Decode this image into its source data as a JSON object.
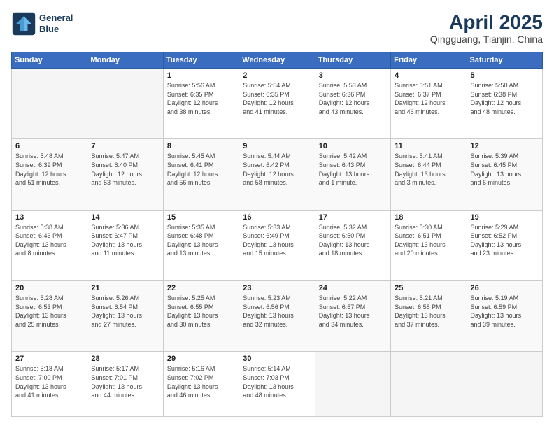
{
  "header": {
    "logo_line1": "General",
    "logo_line2": "Blue",
    "title": "April 2025",
    "subtitle": "Qingguang, Tianjin, China"
  },
  "weekdays": [
    "Sunday",
    "Monday",
    "Tuesday",
    "Wednesday",
    "Thursday",
    "Friday",
    "Saturday"
  ],
  "rows": [
    [
      {
        "day": "",
        "info": ""
      },
      {
        "day": "",
        "info": ""
      },
      {
        "day": "1",
        "info": "Sunrise: 5:56 AM\nSunset: 6:35 PM\nDaylight: 12 hours\nand 38 minutes."
      },
      {
        "day": "2",
        "info": "Sunrise: 5:54 AM\nSunset: 6:35 PM\nDaylight: 12 hours\nand 41 minutes."
      },
      {
        "day": "3",
        "info": "Sunrise: 5:53 AM\nSunset: 6:36 PM\nDaylight: 12 hours\nand 43 minutes."
      },
      {
        "day": "4",
        "info": "Sunrise: 5:51 AM\nSunset: 6:37 PM\nDaylight: 12 hours\nand 46 minutes."
      },
      {
        "day": "5",
        "info": "Sunrise: 5:50 AM\nSunset: 6:38 PM\nDaylight: 12 hours\nand 48 minutes."
      }
    ],
    [
      {
        "day": "6",
        "info": "Sunrise: 5:48 AM\nSunset: 6:39 PM\nDaylight: 12 hours\nand 51 minutes."
      },
      {
        "day": "7",
        "info": "Sunrise: 5:47 AM\nSunset: 6:40 PM\nDaylight: 12 hours\nand 53 minutes."
      },
      {
        "day": "8",
        "info": "Sunrise: 5:45 AM\nSunset: 6:41 PM\nDaylight: 12 hours\nand 56 minutes."
      },
      {
        "day": "9",
        "info": "Sunrise: 5:44 AM\nSunset: 6:42 PM\nDaylight: 12 hours\nand 58 minutes."
      },
      {
        "day": "10",
        "info": "Sunrise: 5:42 AM\nSunset: 6:43 PM\nDaylight: 13 hours\nand 1 minute."
      },
      {
        "day": "11",
        "info": "Sunrise: 5:41 AM\nSunset: 6:44 PM\nDaylight: 13 hours\nand 3 minutes."
      },
      {
        "day": "12",
        "info": "Sunrise: 5:39 AM\nSunset: 6:45 PM\nDaylight: 13 hours\nand 6 minutes."
      }
    ],
    [
      {
        "day": "13",
        "info": "Sunrise: 5:38 AM\nSunset: 6:46 PM\nDaylight: 13 hours\nand 8 minutes."
      },
      {
        "day": "14",
        "info": "Sunrise: 5:36 AM\nSunset: 6:47 PM\nDaylight: 13 hours\nand 11 minutes."
      },
      {
        "day": "15",
        "info": "Sunrise: 5:35 AM\nSunset: 6:48 PM\nDaylight: 13 hours\nand 13 minutes."
      },
      {
        "day": "16",
        "info": "Sunrise: 5:33 AM\nSunset: 6:49 PM\nDaylight: 13 hours\nand 15 minutes."
      },
      {
        "day": "17",
        "info": "Sunrise: 5:32 AM\nSunset: 6:50 PM\nDaylight: 13 hours\nand 18 minutes."
      },
      {
        "day": "18",
        "info": "Sunrise: 5:30 AM\nSunset: 6:51 PM\nDaylight: 13 hours\nand 20 minutes."
      },
      {
        "day": "19",
        "info": "Sunrise: 5:29 AM\nSunset: 6:52 PM\nDaylight: 13 hours\nand 23 minutes."
      }
    ],
    [
      {
        "day": "20",
        "info": "Sunrise: 5:28 AM\nSunset: 6:53 PM\nDaylight: 13 hours\nand 25 minutes."
      },
      {
        "day": "21",
        "info": "Sunrise: 5:26 AM\nSunset: 6:54 PM\nDaylight: 13 hours\nand 27 minutes."
      },
      {
        "day": "22",
        "info": "Sunrise: 5:25 AM\nSunset: 6:55 PM\nDaylight: 13 hours\nand 30 minutes."
      },
      {
        "day": "23",
        "info": "Sunrise: 5:23 AM\nSunset: 6:56 PM\nDaylight: 13 hours\nand 32 minutes."
      },
      {
        "day": "24",
        "info": "Sunrise: 5:22 AM\nSunset: 6:57 PM\nDaylight: 13 hours\nand 34 minutes."
      },
      {
        "day": "25",
        "info": "Sunrise: 5:21 AM\nSunset: 6:58 PM\nDaylight: 13 hours\nand 37 minutes."
      },
      {
        "day": "26",
        "info": "Sunrise: 5:19 AM\nSunset: 6:59 PM\nDaylight: 13 hours\nand 39 minutes."
      }
    ],
    [
      {
        "day": "27",
        "info": "Sunrise: 5:18 AM\nSunset: 7:00 PM\nDaylight: 13 hours\nand 41 minutes."
      },
      {
        "day": "28",
        "info": "Sunrise: 5:17 AM\nSunset: 7:01 PM\nDaylight: 13 hours\nand 44 minutes."
      },
      {
        "day": "29",
        "info": "Sunrise: 5:16 AM\nSunset: 7:02 PM\nDaylight: 13 hours\nand 46 minutes."
      },
      {
        "day": "30",
        "info": "Sunrise: 5:14 AM\nSunset: 7:03 PM\nDaylight: 13 hours\nand 48 minutes."
      },
      {
        "day": "",
        "info": ""
      },
      {
        "day": "",
        "info": ""
      },
      {
        "day": "",
        "info": ""
      }
    ]
  ]
}
